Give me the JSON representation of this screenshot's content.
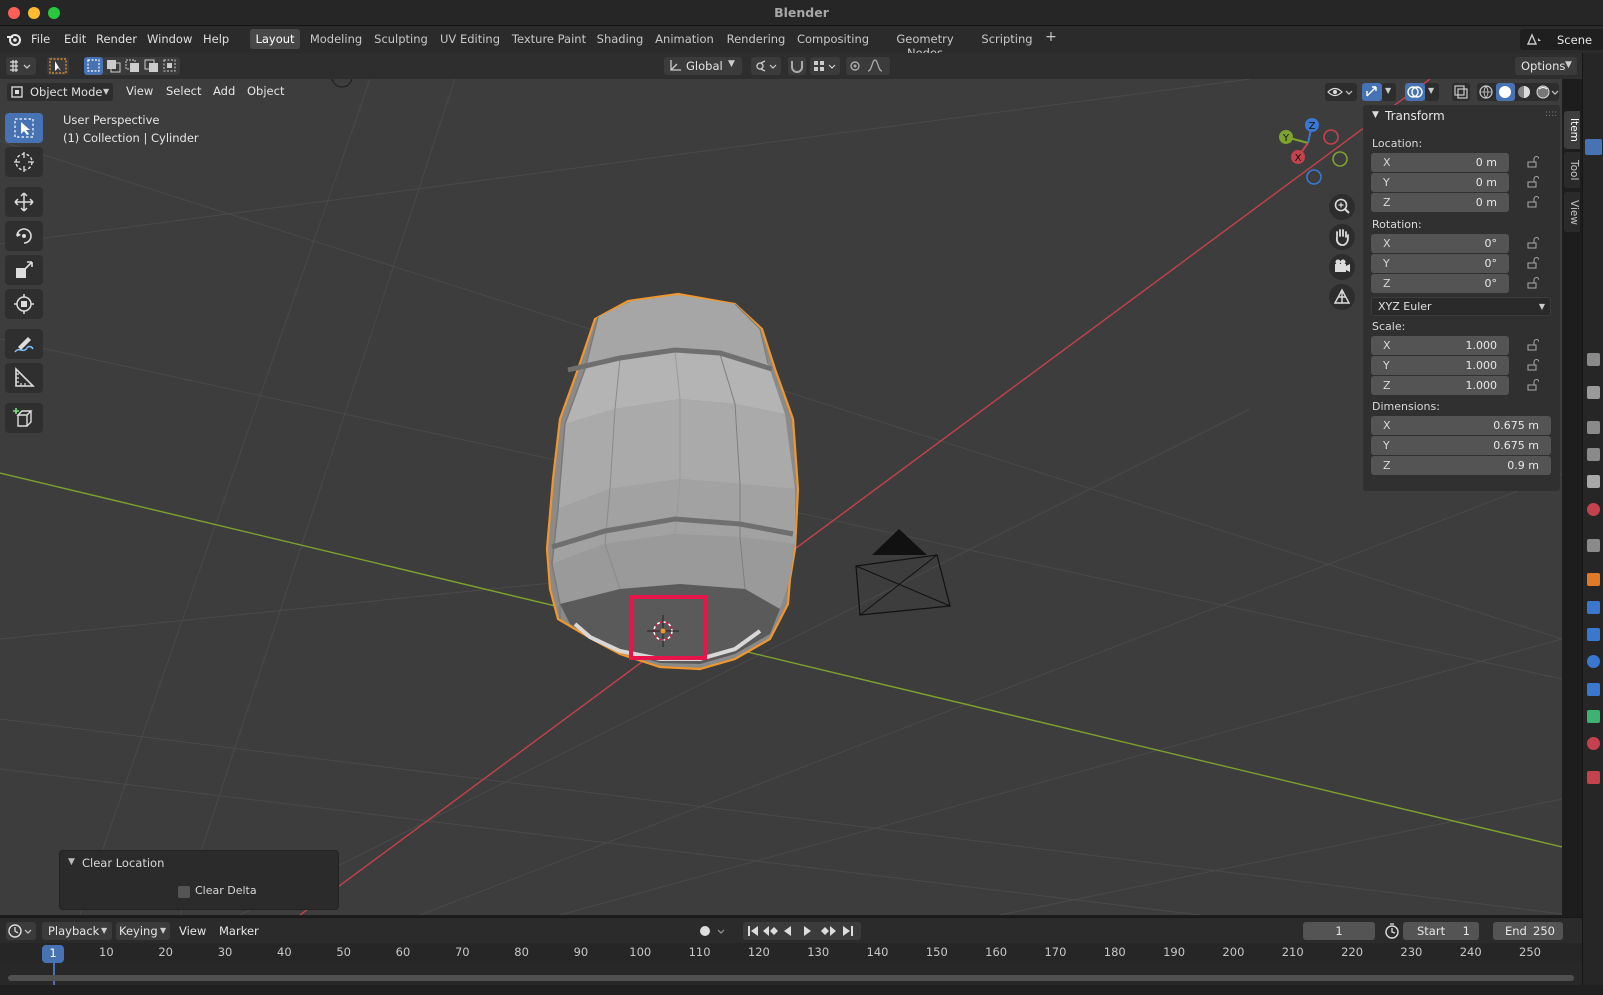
{
  "window": {
    "title": "Blender"
  },
  "menu": [
    "File",
    "Edit",
    "Render",
    "Window",
    "Help"
  ],
  "workspaces": {
    "tabs": [
      "Layout",
      "Modeling",
      "Sculpting",
      "UV Editing",
      "Texture Paint",
      "Shading",
      "Animation",
      "Rendering",
      "Compositing",
      "Geometry Nodes",
      "Scripting"
    ],
    "active": "Layout",
    "add": "+"
  },
  "scene_selector": "Scene",
  "toolbar": {
    "transform_orientation": "Global",
    "options": "Options"
  },
  "viewport_header": {
    "mode": "Object Mode",
    "menus": [
      "View",
      "Select",
      "Add",
      "Object"
    ]
  },
  "viewport": {
    "overlay_title": "User Perspective",
    "overlay_subtitle": "(1) Collection | Cylinder",
    "gizmo_axes": {
      "x": "X",
      "y": "Y",
      "z": "Z"
    }
  },
  "npanel": {
    "tabs": [
      "Item",
      "Tool",
      "View"
    ],
    "active_tab": "Item",
    "section": "Transform",
    "location_label": "Location:",
    "location": [
      {
        "axis": "X",
        "value": "0 m"
      },
      {
        "axis": "Y",
        "value": "0 m"
      },
      {
        "axis": "Z",
        "value": "0 m"
      }
    ],
    "rotation_label": "Rotation:",
    "rotation": [
      {
        "axis": "X",
        "value": "0°"
      },
      {
        "axis": "Y",
        "value": "0°"
      },
      {
        "axis": "Z",
        "value": "0°"
      }
    ],
    "rotation_mode": "XYZ Euler",
    "scale_label": "Scale:",
    "scale": [
      {
        "axis": "X",
        "value": "1.000"
      },
      {
        "axis": "Y",
        "value": "1.000"
      },
      {
        "axis": "Z",
        "value": "1.000"
      }
    ],
    "dimensions_label": "Dimensions:",
    "dimensions": [
      {
        "axis": "X",
        "value": "0.675 m"
      },
      {
        "axis": "Y",
        "value": "0.675 m"
      },
      {
        "axis": "Z",
        "value": "0.9 m"
      }
    ]
  },
  "operator_panel": {
    "title": "Clear Location",
    "checkbox_label": "Clear Delta",
    "checked": false
  },
  "timeline": {
    "menus": [
      "Playback",
      "Keying",
      "View",
      "Marker"
    ],
    "current_frame": "1",
    "start_label": "Start",
    "start": "1",
    "end_label": "End",
    "end": "250",
    "ruler": [
      "10",
      "20",
      "30",
      "40",
      "50",
      "60",
      "70",
      "80",
      "90",
      "100",
      "110",
      "120",
      "130",
      "140",
      "150",
      "160",
      "170",
      "180",
      "190",
      "200",
      "210",
      "220",
      "230",
      "240",
      "250"
    ],
    "playhead": "1"
  },
  "colors": {
    "selection_outline": "#f0962e",
    "highlight_box": "#e8154a",
    "x_axis": "#c4414e",
    "y_axis": "#7ea22e",
    "z_axis": "#3a78d0",
    "accent": "#4772b3"
  }
}
